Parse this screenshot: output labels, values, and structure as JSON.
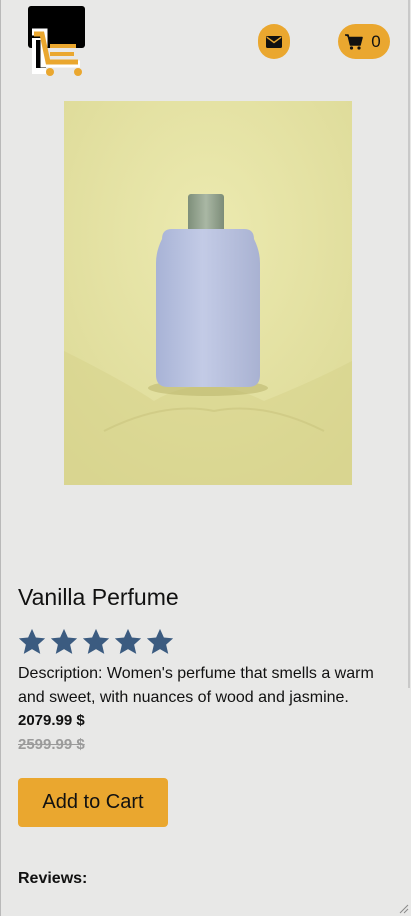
{
  "header": {
    "logo_icon": "store-cart-logo",
    "mail_icon": "envelope-icon",
    "cart_icon": "shopping-cart-icon",
    "cart_count": "0"
  },
  "product": {
    "title": "Vanilla Perfume",
    "rating": 5,
    "rating_max": 5,
    "description": "Description: Women's perfume that smells a warm and sweet, with nuances of wood and jasmine.",
    "price": "2079.99 $",
    "old_price": "2599.99 $",
    "add_to_cart_label": "Add to Cart",
    "image": "perfume-bottle-photo"
  },
  "reviews": {
    "label": "Reviews:"
  },
  "colors": {
    "accent": "#eaa72f",
    "star": "#3b5b80",
    "background": "#e8e8e7"
  }
}
